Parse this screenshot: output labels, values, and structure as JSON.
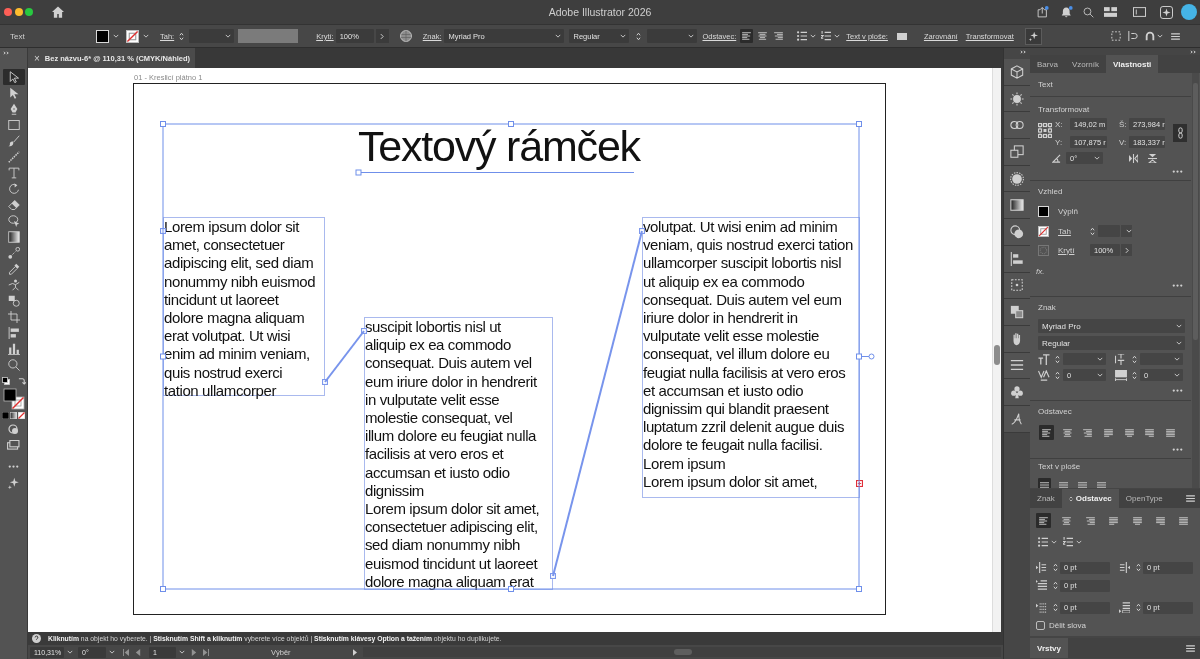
{
  "window": {
    "title": "Adobe Illustrator 2026"
  },
  "control_bar": {
    "selection_type": "Text",
    "stroke_link": "Tah:",
    "opacity_link": "Krytí:",
    "opacity": "100%",
    "character_link": "Znak:",
    "font": "Myriad Pro",
    "font_style": "Regular",
    "paragraph_link": "Odstavec:",
    "alignment": [
      {
        "kind": "left",
        "selected": true
      },
      {
        "kind": "center",
        "selected": false
      },
      {
        "kind": "right",
        "selected": false
      }
    ],
    "area_type_link": "Text v ploše:",
    "align_link": "Zarovnání",
    "transform_link": "Transformovat"
  },
  "tools": [
    {
      "kind": "selection",
      "selected": true
    },
    {
      "kind": "direct-selection",
      "selected": false
    },
    {
      "kind": "pen",
      "selected": false
    },
    {
      "kind": "rectangle",
      "selected": false
    },
    {
      "kind": "paintbrush",
      "selected": false
    },
    {
      "kind": "pencil",
      "selected": false
    },
    {
      "kind": "type",
      "selected": false
    },
    {
      "kind": "rotate",
      "selected": false
    },
    {
      "kind": "eraser",
      "selected": false
    },
    {
      "kind": "shape-builder",
      "selected": false
    },
    {
      "kind": "gradient",
      "selected": false
    },
    {
      "kind": "blend",
      "selected": false
    },
    {
      "kind": "eyedropper",
      "selected": false
    },
    {
      "kind": "puppet-warp",
      "selected": false
    },
    {
      "kind": "live-paint",
      "selected": false
    },
    {
      "kind": "artboard",
      "selected": false
    },
    {
      "kind": "align",
      "selected": false
    },
    {
      "kind": "graph",
      "selected": false
    },
    {
      "kind": "zoom",
      "selected": false
    }
  ],
  "document_tab": {
    "close": "×",
    "title": "Bez názvu-6* @ 110,31 % (CMYK/Náhled)"
  },
  "artboard": {
    "label": "01 - Kreslicí plátno 1",
    "heading": "Textový rámček",
    "text_frames": [
      {
        "paragraphs": [
          "Lorem ipsum dolor sit amet, consectetuer adipiscing elit, sed diam nonummy nibh euismod tincidunt ut laoreet dolore magna aliquam erat volutpat. Ut wisi enim ad minim veniam, quis nostrud exerci tation ullamcorper"
        ],
        "overset": false
      },
      {
        "paragraphs": [
          "suscipit lobortis nisl ut aliquip ex ea commodo consequat. Duis autem vel eum iriure dolor in hendrerit in vulputate velit esse molestie consequat, vel illum dolore eu feugiat nulla facilisis at vero eros et accumsan et iusto odio dignissim",
          "Lorem ipsum dolor sit amet, consectetuer adipiscing elit, sed diam nonummy nibh euismod tincidunt ut laoreet dolore magna aliquam erat"
        ],
        "overset": false
      },
      {
        "paragraphs": [
          "volutpat. Ut wisi enim ad minim veniam, quis nostrud exerci tation ullamcorper suscipit lobortis nisl ut aliquip ex ea commodo consequat. Duis autem vel eum iriure dolor in hendrerit in vulputate velit esse molestie consequat, vel illum dolore eu feugiat nulla facilisis at vero eros et accumsan et iusto odio dignissim qui blandit praesent luptatum zzril delenit augue duis dolore te feugait nulla facilisi.",
          "Lorem ipsum",
          "Lorem ipsum dolor sit amet,"
        ],
        "overset": true
      }
    ]
  },
  "help_bar": {
    "text": "**Kliknutím** na objekt ho vyberete.  |  **Stisknutím Shift a kliknutím** vyberete více objektů  |  **Stisknutím klávesy Option a tažením** objektu ho duplikujete."
  },
  "status_bar": {
    "zoom": "110,31%",
    "rotation": "0°",
    "artboard": "1",
    "tool": "Výběr"
  },
  "properties_panel": {
    "tabs": [
      {
        "label": "Barva",
        "selected": false
      },
      {
        "label": "Vzorník",
        "selected": false
      },
      {
        "label": "Vlastnosti",
        "selected": true
      }
    ],
    "selection_type": "Text",
    "transform": {
      "title": "Transformovat",
      "fields": [
        {
          "label": "X:",
          "value": "149,02 m"
        },
        {
          "label": "Š:",
          "value": "273,984 r"
        },
        {
          "label": "Y:",
          "value": "107,875 r"
        },
        {
          "label": "V:",
          "value": "183,337 r"
        }
      ],
      "angle": "0°"
    },
    "appearance": {
      "title": "Vzhled",
      "fill_label": "Výplň",
      "stroke_link": "Tah",
      "opacity_link": "Krytí",
      "opacity": "100%",
      "effects": "fx."
    },
    "character": {
      "title": "Znak",
      "font": "Myriad Pro",
      "font_style": "Regular",
      "kerning": "0",
      "tracking": "0"
    },
    "paragraph": {
      "title": "Odstavec",
      "alignment": [
        {
          "kind": "left",
          "selected": true
        },
        {
          "kind": "center",
          "selected": false
        },
        {
          "kind": "right",
          "selected": false
        },
        {
          "kind": "justify-left",
          "selected": false
        },
        {
          "kind": "justify-center",
          "selected": false
        },
        {
          "kind": "justify-right",
          "selected": false
        },
        {
          "kind": "justify-all",
          "selected": false
        }
      ]
    },
    "area_type": {
      "title": "Text v ploše",
      "options": [
        {
          "selected": true
        },
        {
          "selected": false
        },
        {
          "selected": false
        },
        {
          "selected": false
        }
      ]
    }
  },
  "paragraph_panel": {
    "tabs": [
      {
        "label": "Znak",
        "selected": false
      },
      {
        "label": "Odstavec",
        "selected": true
      },
      {
        "label": "OpenType",
        "selected": false
      }
    ],
    "alignment": [
      {
        "kind": "left",
        "selected": true
      },
      {
        "kind": "center",
        "selected": false
      },
      {
        "kind": "right",
        "selected": false
      },
      {
        "kind": "justify-left",
        "selected": false
      },
      {
        "kind": "justify-center",
        "selected": false
      },
      {
        "kind": "justify-right",
        "selected": false
      },
      {
        "kind": "justify-all",
        "selected": false
      }
    ],
    "indents": [
      {
        "kind": "left-indent",
        "value": "0 pt"
      },
      {
        "kind": "right-indent",
        "value": "0 pt"
      },
      {
        "kind": "first-line-indent",
        "value": "0 pt"
      },
      {
        "kind": "space-before",
        "value": "0 pt"
      },
      {
        "kind": "space-after",
        "value": "0 pt"
      }
    ],
    "hyphenate": {
      "label": "Dělit slova",
      "checked": false
    }
  },
  "layers_panel": {
    "tab": "Vrstvy"
  }
}
